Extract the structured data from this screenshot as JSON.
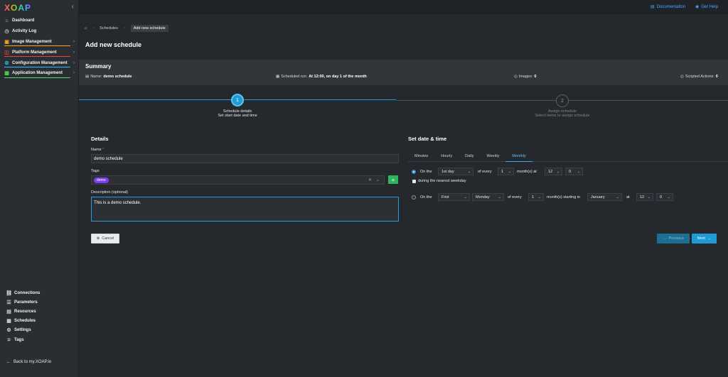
{
  "sidebar": {
    "logo": "XOAP",
    "collapse_icon": "chevron-left-icon",
    "items": [
      {
        "label": "Dashboard",
        "icon": "home-icon",
        "has_chevron": false
      },
      {
        "label": "Activity Log",
        "icon": "clock-icon",
        "has_chevron": false
      },
      {
        "label": "Image Management",
        "icon": "image-icon",
        "has_chevron": true,
        "accent": "#f5a623"
      },
      {
        "label": "Platform Management",
        "icon": "layers-icon",
        "has_chevron": true,
        "accent": "#e8423c"
      },
      {
        "label": "Configuration Management",
        "icon": "config-icon",
        "has_chevron": true,
        "accent": "#27c4ff"
      },
      {
        "label": "Application Management",
        "icon": "apps-icon",
        "has_chevron": true,
        "accent": "#4ddc56"
      }
    ],
    "bottom_items": [
      {
        "label": "Connections",
        "icon": "link-icon"
      },
      {
        "label": "Parameters",
        "icon": "list-icon"
      },
      {
        "label": "Resources",
        "icon": "resources-icon"
      },
      {
        "label": "Schedules",
        "icon": "calendar-icon"
      },
      {
        "label": "Settings",
        "icon": "gear-icon"
      },
      {
        "label": "Tags",
        "icon": "tag-icon"
      }
    ],
    "back_link": "Back to my.XOAP.io"
  },
  "topbar": {
    "documentation": "Documentation",
    "get_help": "Get Help"
  },
  "breadcrumb": {
    "items": [
      "Schedules",
      "Add new schedule"
    ]
  },
  "page_title": "Add new schedule",
  "summary": {
    "title": "Summary",
    "name_label": "Name:",
    "name_value": "demo schedule",
    "run_label": "Scheduled run:",
    "run_value": "At 12:00, on day 1 of the month",
    "images_label": "Images:",
    "images_value": "0",
    "scripted_label": "Scripted Actions:",
    "scripted_value": "0"
  },
  "stepper": {
    "steps": [
      {
        "number": "1",
        "title": "Schedule details",
        "subtitle": "Set start date and time",
        "active": true
      },
      {
        "number": "2",
        "title": "Assign schedule",
        "subtitle": "Select items to assign schedule",
        "active": false
      }
    ]
  },
  "details": {
    "title": "Details",
    "name_label": "Name",
    "name_required": "*",
    "name_value": "demo schedule",
    "tags_label": "Tags",
    "tag_chip": "demo",
    "description_label": "Description (optional)",
    "description_value": "This is a demo schedule."
  },
  "schedule": {
    "title": "Set date & time",
    "tabs": [
      "Minutes",
      "Hourly",
      "Daily",
      "Weekly",
      "Monthly"
    ],
    "active_tab": "Monthly",
    "option1": {
      "on_the": "On the",
      "day": "1st day",
      "of_every": "of every",
      "every_value": "1",
      "months_at": "month(s) at",
      "hour": "12",
      "minute": "0",
      "checkbox_label": "during the nearest weekday"
    },
    "option2": {
      "on_the": "On the",
      "ordinal": "First",
      "weekday": "Monday",
      "of_every": "of every",
      "every_value": "1",
      "starting_in": "month(s) starting in",
      "month": "January",
      "at": "at",
      "hour": "12",
      "minute": "0"
    }
  },
  "buttons": {
    "cancel": "Cancel",
    "previous": "Previous",
    "next": "Next"
  },
  "colors": {
    "accent": "#1f9bd6",
    "tag": "#7b3ff0",
    "add": "#2fb55c"
  }
}
